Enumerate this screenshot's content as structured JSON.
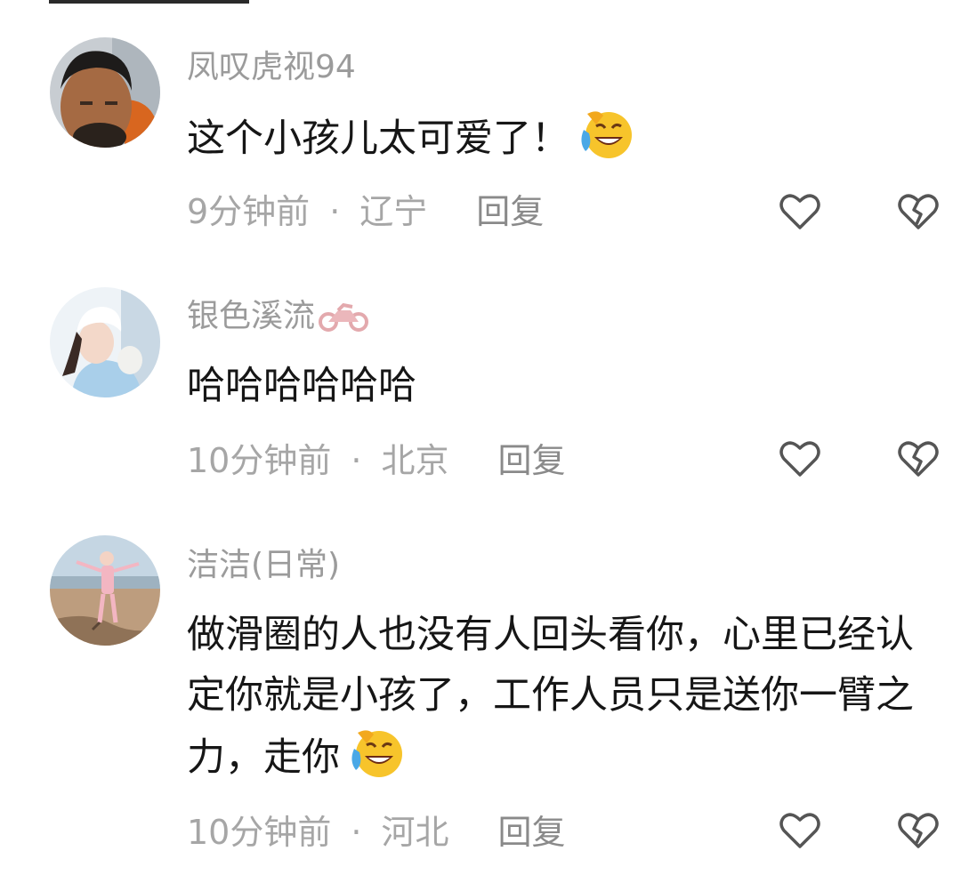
{
  "comments": [
    {
      "username": "凤叹虎视94",
      "content": "这个小孩儿太可爱了！",
      "emoji": "rofl-emoji",
      "time": "9分钟前",
      "separator": "·",
      "location": "辽宁",
      "reply_label": "回复"
    },
    {
      "username": "银色溪流",
      "username_badge": "motorcycle-icon",
      "content": "哈哈哈哈哈哈",
      "time": "10分钟前",
      "separator": "·",
      "location": "北京",
      "reply_label": "回复"
    },
    {
      "username": "洁洁(日常)",
      "content": "做滑圈的人也没有人回头看你，心里已经认定你就是小孩了，工作人员只是送你一臂之力，走你",
      "emoji": "rofl-emoji",
      "time": "10分钟前",
      "separator": "·",
      "location": "河北",
      "reply_label": "回复"
    }
  ],
  "icons": {
    "like": "heart-outline-icon",
    "dislike": "broken-heart-outline-icon"
  },
  "colors": {
    "username": "#9b9b9b",
    "content": "#161616",
    "meta": "#a6a6a6",
    "icon": "#555555"
  }
}
